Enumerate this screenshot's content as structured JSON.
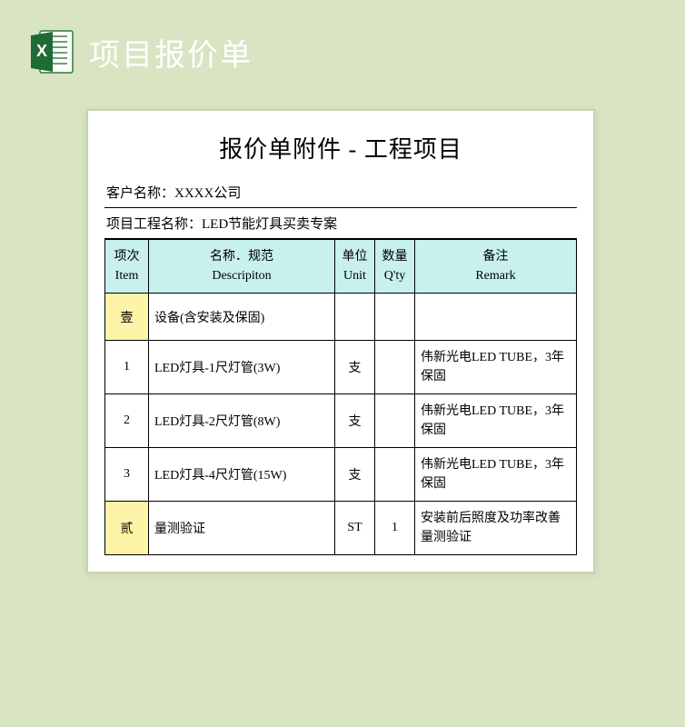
{
  "header": {
    "title": "项目报价单"
  },
  "doc": {
    "title": "报价单附件 - 工程项目",
    "customer_label": "客户名称：",
    "customer_value": "XXXX公司",
    "project_label": "项目工程名称：",
    "project_value": "LED节能灯具买卖专案"
  },
  "columns": {
    "item_cn": "项次",
    "item_en": "Item",
    "desc_cn": "名称．规范",
    "desc_en": "Descripiton",
    "unit_cn": "单位",
    "unit_en": "Unit",
    "qty_cn": "数量",
    "qty_en": "Q'ty",
    "remark_cn": "备注",
    "remark_en": "Remark"
  },
  "rows": [
    {
      "type": "section",
      "num": "壹",
      "desc": "设备(含安装及保固)",
      "unit": "",
      "qty": "",
      "remark": ""
    },
    {
      "type": "item",
      "num": "1",
      "desc": "LED灯具-1尺灯管(3W)",
      "unit": "支",
      "qty": "",
      "remark": "伟新光电LED TUBE，3年保固"
    },
    {
      "type": "item",
      "num": "2",
      "desc": "LED灯具-2尺灯管(8W)",
      "unit": "支",
      "qty": "",
      "remark": "伟新光电LED TUBE，3年保固"
    },
    {
      "type": "item",
      "num": "3",
      "desc": "LED灯具-4尺灯管(15W)",
      "unit": "支",
      "qty": "",
      "remark": "伟新光电LED TUBE，3年保固"
    },
    {
      "type": "section",
      "num": "贰",
      "desc": "量测验证",
      "unit": "ST",
      "qty": "1",
      "remark": "安装前后照度及功率改善量测验证"
    }
  ]
}
